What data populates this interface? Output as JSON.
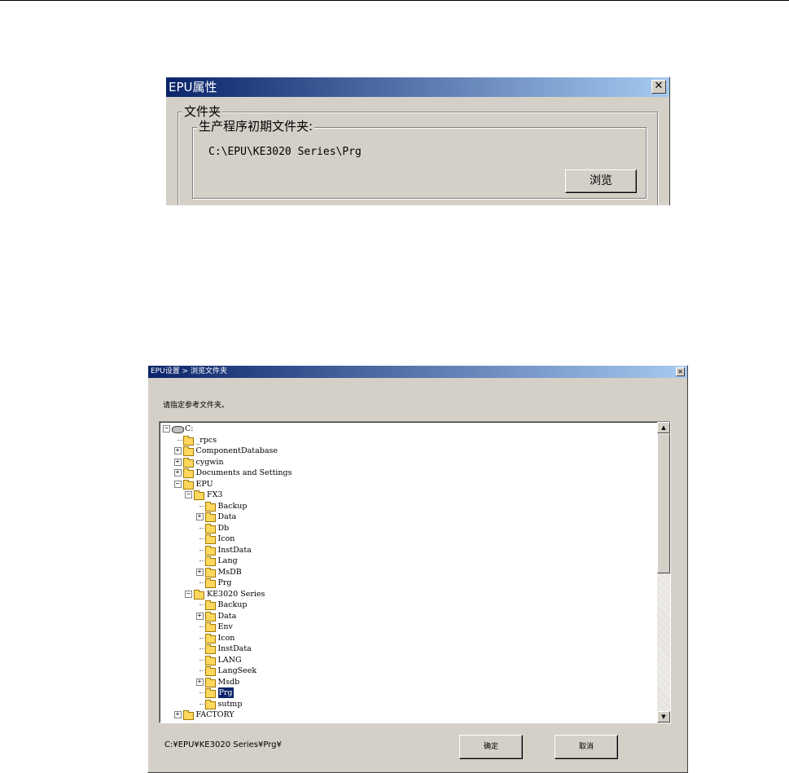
{
  "dialog1": {
    "title": "EPU属性",
    "close_glyph": "✕",
    "group_outer_label": "文件夹",
    "group_inner_label": "生产程序初期文件夹:",
    "path_value": "C:\\EPU\\KE3020 Series\\Prg",
    "browse_label": "浏览"
  },
  "dialog2": {
    "title": "EPU设置 > 浏览文件夹",
    "close_glyph": "✕",
    "prompt": "请指定参考文件夹。",
    "tree": [
      {
        "label": "C:",
        "level": 0,
        "expander": "minus",
        "icon": "drive-icon"
      },
      {
        "label": "_rpcs",
        "level": 1,
        "expander": "none",
        "icon": "folder-icon"
      },
      {
        "label": "ComponentDatabase",
        "level": 1,
        "expander": "plus",
        "icon": "folder-icon"
      },
      {
        "label": "cygwin",
        "level": 1,
        "expander": "plus",
        "icon": "folder-icon"
      },
      {
        "label": "Documents and Settings",
        "level": 1,
        "expander": "plus",
        "icon": "folder-icon"
      },
      {
        "label": "EPU",
        "level": 1,
        "expander": "minus",
        "icon": "folder-icon"
      },
      {
        "label": "FX3",
        "level": 2,
        "expander": "minus",
        "icon": "folder-icon"
      },
      {
        "label": "Backup",
        "level": 3,
        "expander": "none",
        "icon": "folder-icon"
      },
      {
        "label": "Data",
        "level": 3,
        "expander": "plus",
        "icon": "folder-icon"
      },
      {
        "label": "Db",
        "level": 3,
        "expander": "none",
        "icon": "folder-icon"
      },
      {
        "label": "Icon",
        "level": 3,
        "expander": "none",
        "icon": "folder-icon"
      },
      {
        "label": "InstData",
        "level": 3,
        "expander": "none",
        "icon": "folder-icon"
      },
      {
        "label": "Lang",
        "level": 3,
        "expander": "none",
        "icon": "folder-icon"
      },
      {
        "label": "MsDB",
        "level": 3,
        "expander": "plus",
        "icon": "folder-icon"
      },
      {
        "label": "Prg",
        "level": 3,
        "expander": "none",
        "icon": "folder-icon"
      },
      {
        "label": "KE3020 Series",
        "level": 2,
        "expander": "minus",
        "icon": "folder-icon"
      },
      {
        "label": "Backup",
        "level": 3,
        "expander": "none",
        "icon": "folder-icon"
      },
      {
        "label": "Data",
        "level": 3,
        "expander": "plus",
        "icon": "folder-icon"
      },
      {
        "label": "Env",
        "level": 3,
        "expander": "none",
        "icon": "folder-icon"
      },
      {
        "label": "Icon",
        "level": 3,
        "expander": "none",
        "icon": "folder-icon"
      },
      {
        "label": "InstData",
        "level": 3,
        "expander": "none",
        "icon": "folder-icon"
      },
      {
        "label": "LANG",
        "level": 3,
        "expander": "none",
        "icon": "folder-icon"
      },
      {
        "label": "LangSeek",
        "level": 3,
        "expander": "none",
        "icon": "folder-icon"
      },
      {
        "label": "Msdb",
        "level": 3,
        "expander": "plus",
        "icon": "folder-icon"
      },
      {
        "label": "Prg",
        "level": 3,
        "expander": "none",
        "icon": "open-folder-icon",
        "selected": true
      },
      {
        "label": "sutmp",
        "level": 3,
        "expander": "none",
        "icon": "folder-icon"
      },
      {
        "label": "FACTORY",
        "level": 1,
        "expander": "plus",
        "icon": "folder-icon"
      }
    ],
    "scroll_up_glyph": "▲",
    "scroll_down_glyph": "▼",
    "selected_path": "C:¥EPU¥KE3020 Series¥Prg¥",
    "ok_label": "确定",
    "cancel_label": "取消"
  }
}
